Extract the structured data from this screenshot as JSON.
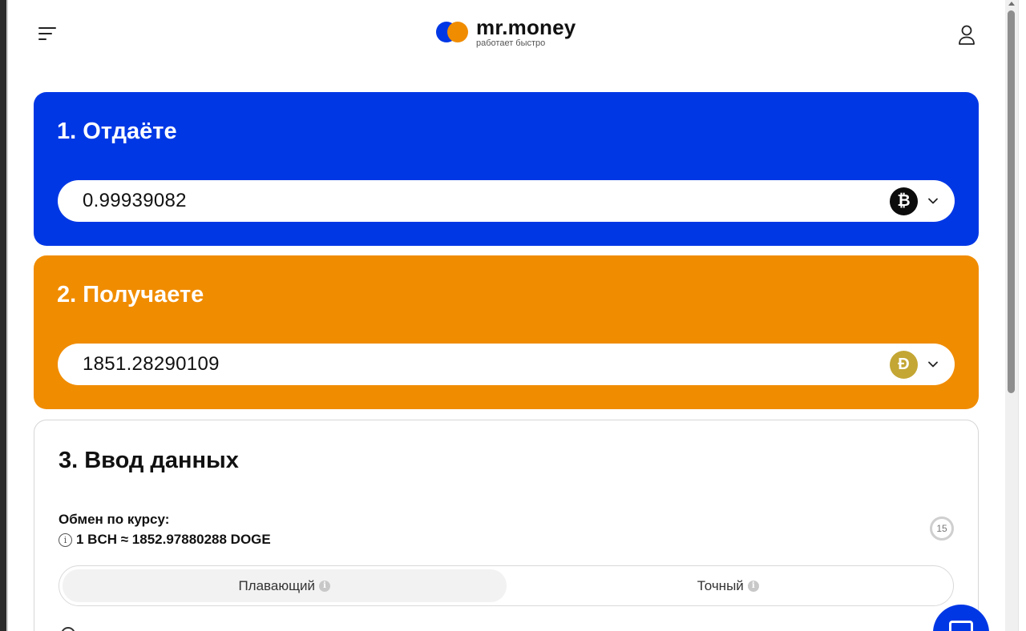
{
  "header": {
    "brand_name": "mr.money",
    "brand_tagline": "работает быстро"
  },
  "give": {
    "title": "1. Отдаёте",
    "amount": "0.99939082",
    "coin_icon": "bitcoin-cash-icon",
    "coin_symbol": "₿",
    "color": "#0037e5"
  },
  "receive": {
    "title": "2. Получаете",
    "amount": "1851.28290109",
    "coin_icon": "dogecoin-icon",
    "coin_symbol": "Ð",
    "color": "#f08c00"
  },
  "details": {
    "title": "3. Ввод данных",
    "rate_label": "Обмен по курсу:",
    "rate_value": "1 BCH ≈ 1852.97880288 DOGE",
    "timer": "15",
    "rate_types": [
      {
        "label": "Плавающий",
        "active": true
      },
      {
        "label": "Точный",
        "active": false
      }
    ]
  }
}
